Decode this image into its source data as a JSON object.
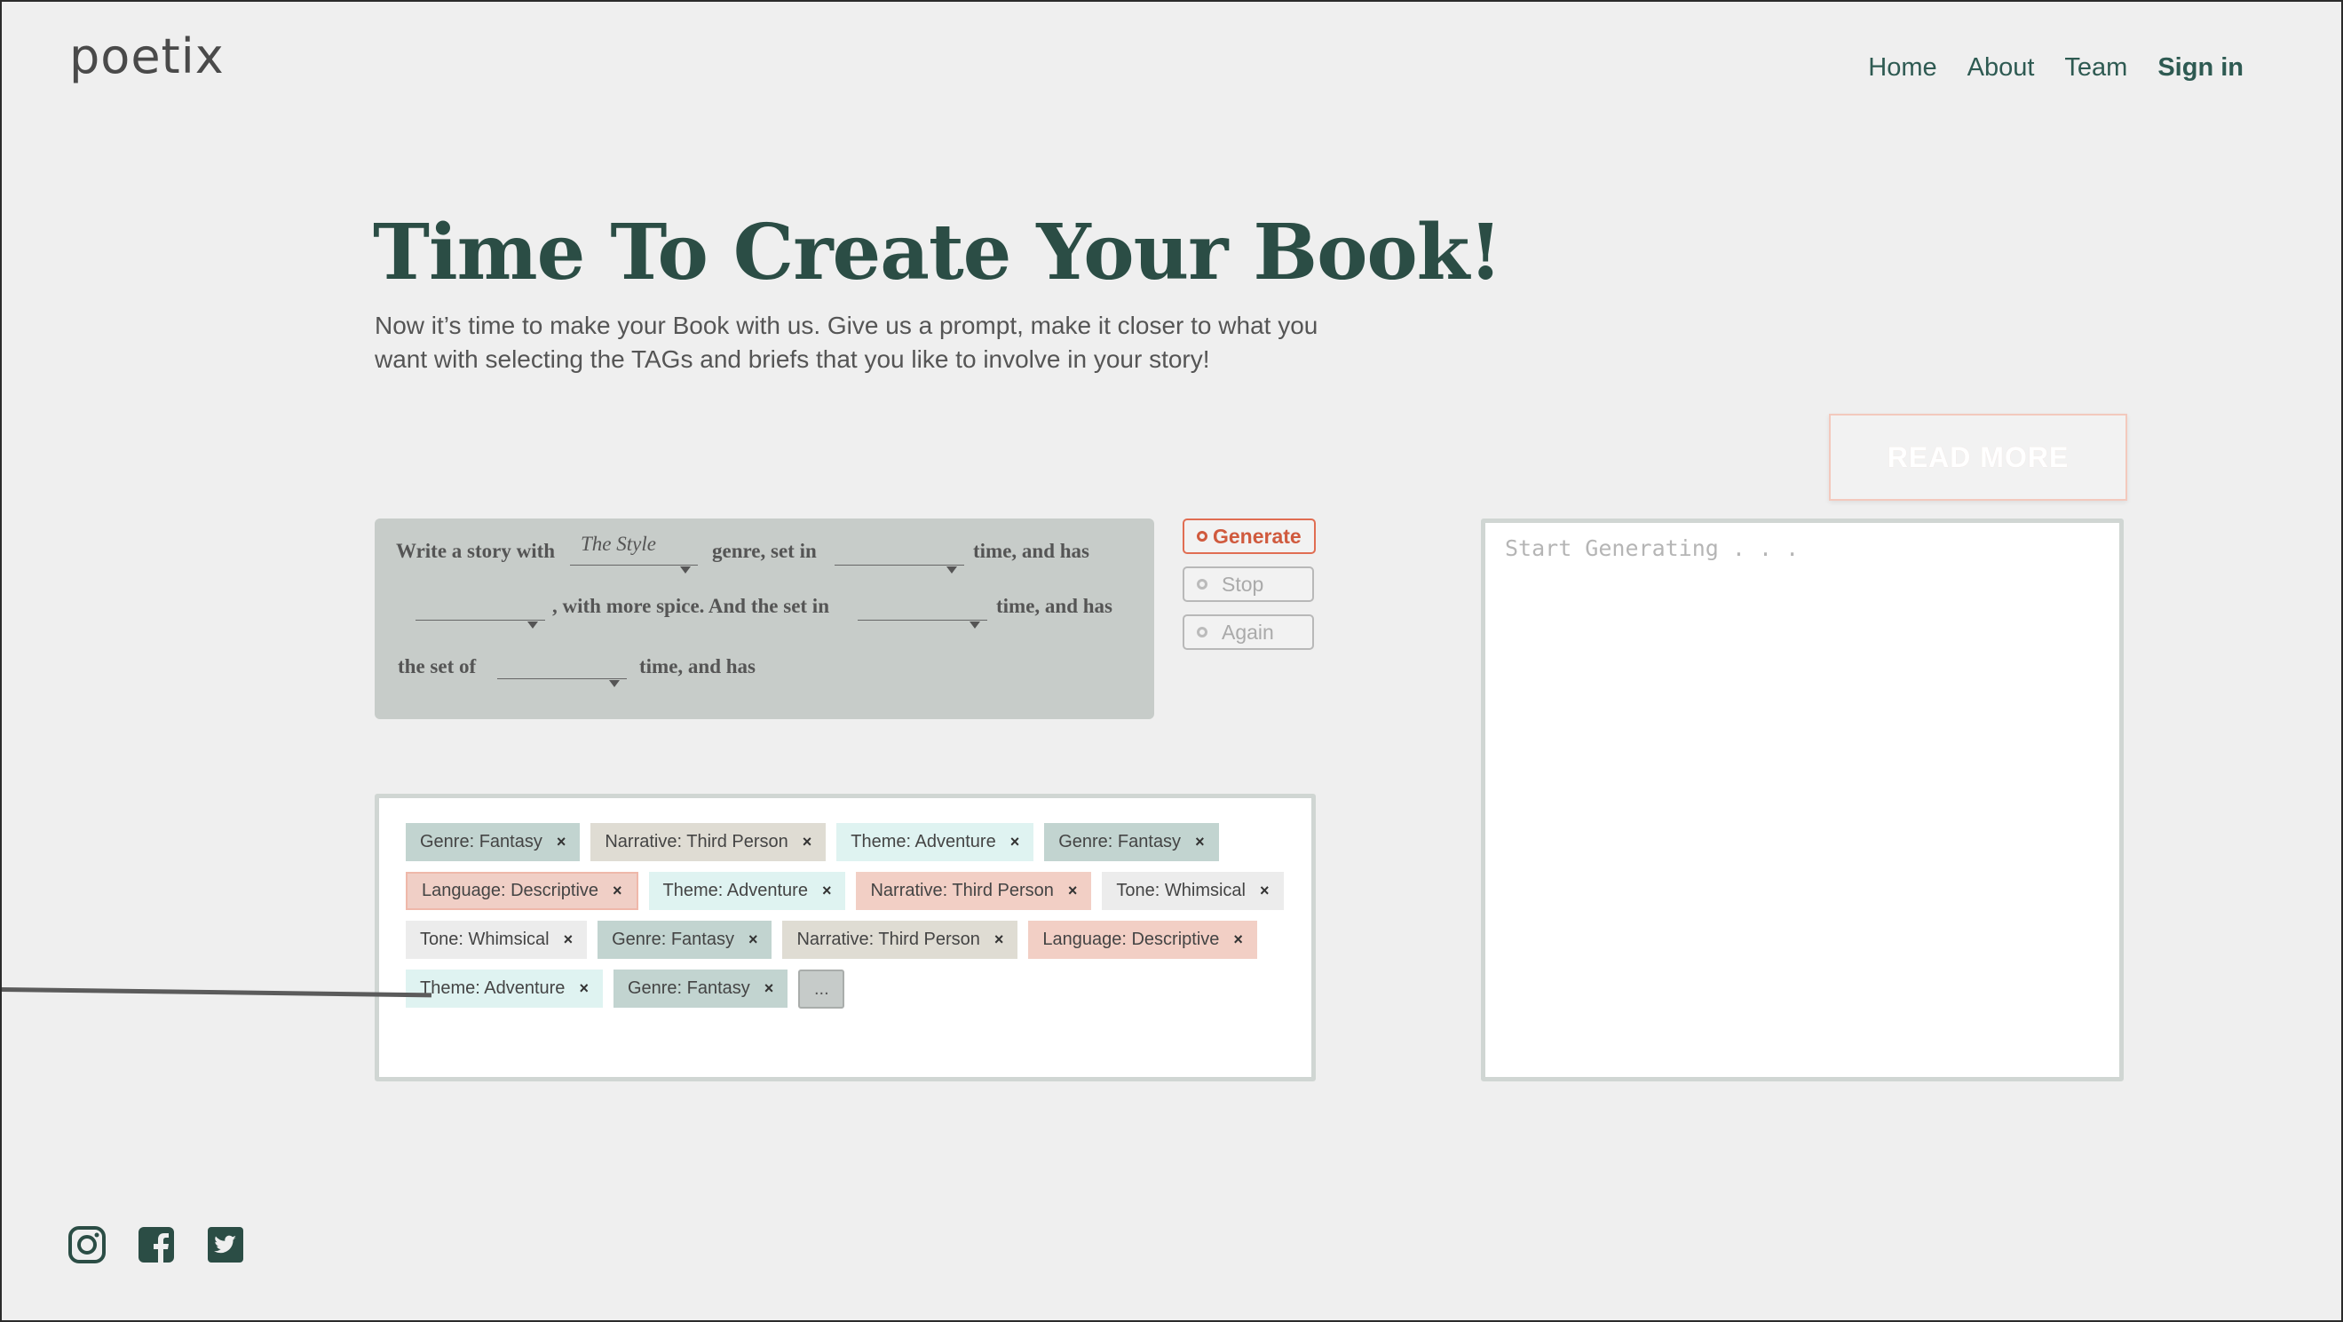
{
  "brand": {
    "logo": "poetix"
  },
  "nav": {
    "items": [
      "Home",
      "About",
      "Team"
    ],
    "signin": "Sign in"
  },
  "hero": {
    "title": "Time To Create Your Book!",
    "subtitle": "Now it’s time to make your Book with us. Give us a prompt, make it closer to what you want with selecting the TAGs and briefs that you like to involve in your story!"
  },
  "read_more": "READ MORE",
  "prompt": {
    "t1": "Write a story with",
    "slot_style": "The Style",
    "t2": "genre, set in",
    "t3": "time, and has",
    "t4": ", with more spice.  And the set in",
    "t5": "time, and has",
    "t6": "the set of",
    "t7": "time, and has"
  },
  "controls": {
    "generate": "Generate",
    "stop": "Stop",
    "again": "Again"
  },
  "tags": [
    {
      "label": "Genre: Fantasy",
      "color": "#c2d4d0"
    },
    {
      "label": "Narrative: Third Person",
      "color": "#dfdcd3"
    },
    {
      "label": "Theme: Adventure",
      "color": "#dff3f1"
    },
    {
      "label": "Genre: Fantasy",
      "color": "#c2d4d0"
    },
    {
      "label": "Language: Descriptive",
      "color": "#f0cfc6"
    },
    {
      "label": "Theme: Adventure",
      "color": "#dff3f1"
    },
    {
      "label": "Narrative: Third Person",
      "color": "#f2cfc5"
    },
    {
      "label": "Tone: Whimsical",
      "color": "#ececec"
    },
    {
      "label": "Tone: Whimsical",
      "color": "#ececec"
    },
    {
      "label": "Genre: Fantasy",
      "color": "#c2d4d0"
    },
    {
      "label": "Narrative: Third Person",
      "color": "#dfdcd3"
    },
    {
      "label": "Language: Descriptive",
      "color": "#f2cfc5"
    },
    {
      "label": "Theme: Adventure",
      "color": "#dff3f1"
    },
    {
      "label": "Genre: Fantasy",
      "color": "#c2d4d0"
    }
  ],
  "tags_more": "...",
  "tag_remove_glyph": "×",
  "output": {
    "placeholder": "Start Generating . . ."
  },
  "social": [
    "instagram-icon",
    "facebook-icon",
    "twitter-icon"
  ],
  "colors": {
    "brand_green": "#2b4d45",
    "accent": "#d05a3e",
    "background": "#efefef"
  }
}
